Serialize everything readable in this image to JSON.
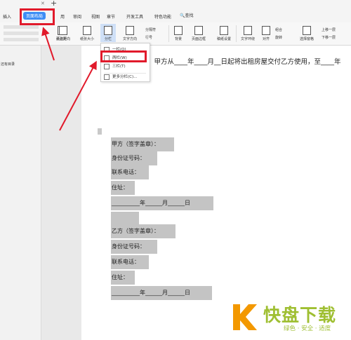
{
  "window": {
    "new_tab": "+"
  },
  "tabs": [
    {
      "label": "插入"
    },
    {
      "label": "页面布局"
    },
    {
      "label": "用"
    },
    {
      "label": "审阅"
    },
    {
      "label": "视图"
    },
    {
      "label": "章节"
    },
    {
      "label": "开发工具"
    },
    {
      "label": "特色功能"
    }
  ],
  "search_label": "查找",
  "ribbon": {
    "margins": "页边距",
    "orientation": "纸张方向",
    "size": "纸张大小",
    "columns": "分栏",
    "text_direction": "文字方向",
    "breaks": "分隔符",
    "line_numbers": "行号",
    "background": "背景",
    "border": "页面边框",
    "manuscript": "稿纸设置",
    "wrap": "文字环绕",
    "align": "对齐",
    "group": "组合",
    "rotate": "旋转",
    "selection_pane": "选择窗格",
    "up": "上移一层",
    "down": "下移一层"
  },
  "sidebar": {
    "label": "还有目录"
  },
  "columns_menu": {
    "one": "一栏(O)",
    "two": "两栏(W)",
    "three": "三栏(T)",
    "more": "更多分栏(C)..."
  },
  "document": {
    "body_line": "，甲方从____年____月__日起将出租房屋交付乙方使用，至____年",
    "party_a": "甲方（签字盖章）：",
    "party_a_id": "身份证号码：",
    "party_a_phone": "联系电话：",
    "party_a_addr": "住址：",
    "party_a_date": "__________年______月______日",
    "party_b": "乙方（签字盖章）：",
    "party_b_id": "身份证号码：",
    "party_b_phone": "联系电话：",
    "party_b_addr": "住址：",
    "party_b_date": "__________年______月______日"
  },
  "watermark": {
    "title": "快盘下载",
    "slogan": "绿色 · 安全 · 适度"
  },
  "colors": {
    "accent": "#3d8df5",
    "highlight": "#e11a2b",
    "brand": "#9fbf32"
  }
}
